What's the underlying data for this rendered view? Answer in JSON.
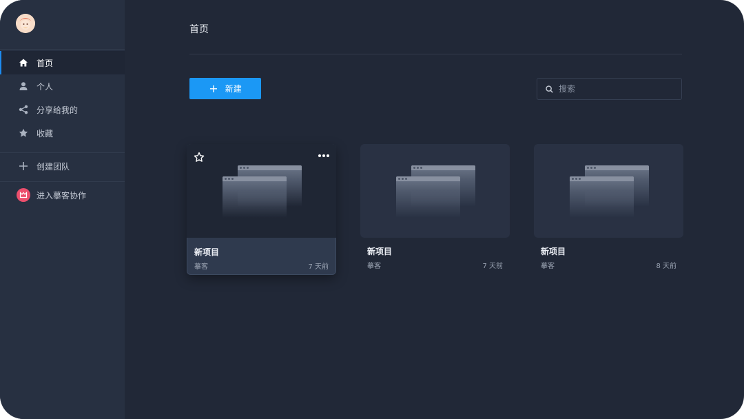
{
  "page": {
    "title": "首页"
  },
  "sidebar": {
    "items": [
      {
        "label": "首页",
        "icon": "home-icon",
        "active": true
      },
      {
        "label": "个人",
        "icon": "user-icon",
        "active": false
      },
      {
        "label": "分享给我的",
        "icon": "share-icon",
        "active": false
      },
      {
        "label": "收藏",
        "icon": "star-icon",
        "active": false
      }
    ],
    "create_team": {
      "label": "创建团队",
      "icon": "plus-icon"
    },
    "collab": {
      "label": "进入摹客协作",
      "icon": "collab-logo-icon"
    }
  },
  "toolbar": {
    "new_label": "新建"
  },
  "search": {
    "placeholder": "搜索",
    "icon": "search-icon"
  },
  "projects": [
    {
      "title": "新项目",
      "owner": "摹客",
      "time": "7 天前"
    },
    {
      "title": "新项目",
      "owner": "摹客",
      "time": "7 天前"
    },
    {
      "title": "新项目",
      "owner": "摹客",
      "time": "8 天前"
    }
  ],
  "colors": {
    "accent": "#1b98f5",
    "sidebar_bg": "#273041",
    "main_bg": "#212837",
    "collab_badge": "#ec4f6d"
  }
}
